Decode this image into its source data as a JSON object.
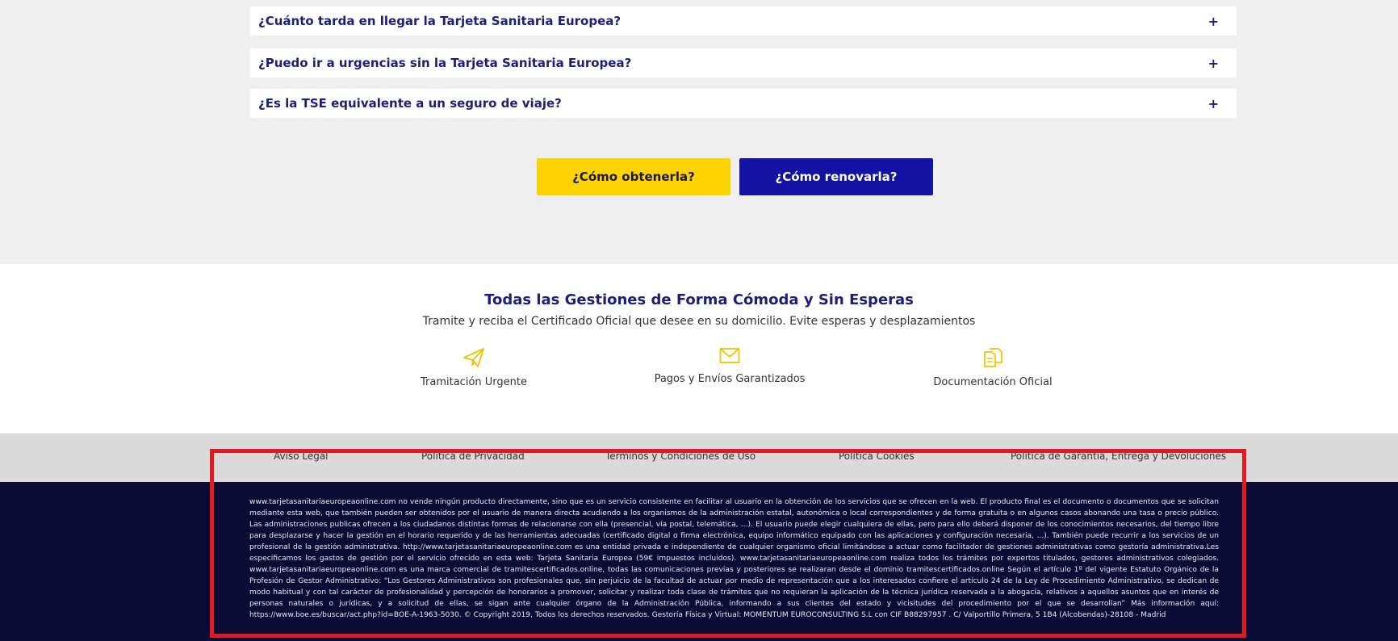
{
  "faq": [
    {
      "question": "¿Cuánto tarda en llegar la Tarjeta Sanitaria Europea?",
      "toggle": "+"
    },
    {
      "question": "¿Puedo ir a urgencias sin la Tarjeta Sanitaria Europea?",
      "toggle": "+"
    },
    {
      "question": "¿Es la TSE equivalente a un seguro de viaje?",
      "toggle": "+"
    }
  ],
  "actions": {
    "obtain_label": "¿Cómo obtenerla?",
    "renew_label": "¿Cómo renovarla?"
  },
  "features": {
    "title": "Todas las Gestiones de Forma Cómoda y Sin Esperas",
    "subtitle": "Tramite y reciba el Certificado Oficial que desee en su domicilio. Evite esperas y desplazamientos",
    "items": [
      {
        "icon": "paper-plane-icon",
        "label": "Tramitación Urgente"
      },
      {
        "icon": "envelope-icon",
        "label": "Pagos y Envíos Garantizados"
      },
      {
        "icon": "documents-icon",
        "label": "Documentación Oficial"
      }
    ]
  },
  "footer_links": [
    "Aviso Legal",
    "Política de Privacidad",
    "Términos y Condiciones de Uso",
    "Política Cookies",
    "Política de Garantía, Entrega y Devoluciones"
  ],
  "legal_text": "www.tarjetasanitariaeuropeaonline.com no vende ningún producto directamente, sino que es un servicio consistente en facilitar al usuario en la obtención de los servicios que se ofrecen en la web. El producto final es el documento o documentos que se solicitan mediante esta web, que también pueden ser obtenidos por el usuario de manera directa acudiendo a los organismos de la administración estatal, autonómica o local correspondientes y de forma gratuita o en algunos casos abonando una tasa o precio público. Las administraciones publicas ofrecen a los ciudadanos distintas formas de relacionarse con ella (presencial, vía postal, telemática, ...). El usuario puede elegir cualquiera de ellas, pero para ello deberá disponer de los conocimientos necesarios, del tiempo libre para desplazarse y hacer la gestión en el horario requerido y de las herramientas adecuadas (certificado digital o firma electrónica, equipo informático equipado con las aplicaciones y configuración necesaria, ...). También puede recurrir a los servicios de un profesional de la gestión administrativa. http://www.tarjetasanitariaeuropeaonline.com es una entidad privada e independiente de cualquier organismo oficial limitándose a actuar como facilitador de gestiones administrativas como gestoría administrativa.Les especificamos los gastos de gestión por el servicio ofrecido en esta web: Tarjeta Sanitaria Europea (59€ impuestos incluidos). www.tarjetasanitariaeuropeaonline.com realiza todos los trámites por expertos titulados, gestores administrativos colegiados. www.tarjetasanitariaeuropeaonline.com es una marca comercial de tramitescertificados.online, todas las comunicaciones previas y posteriores se realizaran desde el dominio tramitescertificados.online Según el artículo 1º del vigente Estatuto Orgánico de la Profesión de Gestor Administrativo: “Los Gestores Administrativos son profesionales que, sin perjuicio de la facultad de actuar por medio de representación que a los interesados confiere el artículo 24 de la Ley de Procedimiento Administrativo, se dedican de modo habitual y con tal carácter de profesionalidad y percepción de honorarios a promover, solicitar y realizar toda clase de trámites que no requieran la aplicación de la técnica jurídica reservada a la abogacía, relativos a aquellos asuntos que en interés de personas naturales o jurídicas, y a solicitud de ellas, se sigan ante cualquier órgano de la Administración Pública, informando a sus clientes del estado y vicisitudes del procedimiento por el que se desarrollan” Más información aquí: https://www.boe.es/buscar/act.php?id=BOE-A-1963-5030. © Copyright 2019, Todos los derechos reservados. Gestoría Física y Virtual: MOMENTUM EUROCONSULTING S.L con CIF B88297957 . C/ Valportillo Primera, 5 1B4 (Alcobendas)-28108 - Madrid",
  "colors": {
    "accent_yellow": "#fed302",
    "accent_blue": "#1212a3",
    "heading_navy": "#1c1f7a",
    "footer_dark": "#0b0b36",
    "highlight_red": "#e11b22"
  }
}
